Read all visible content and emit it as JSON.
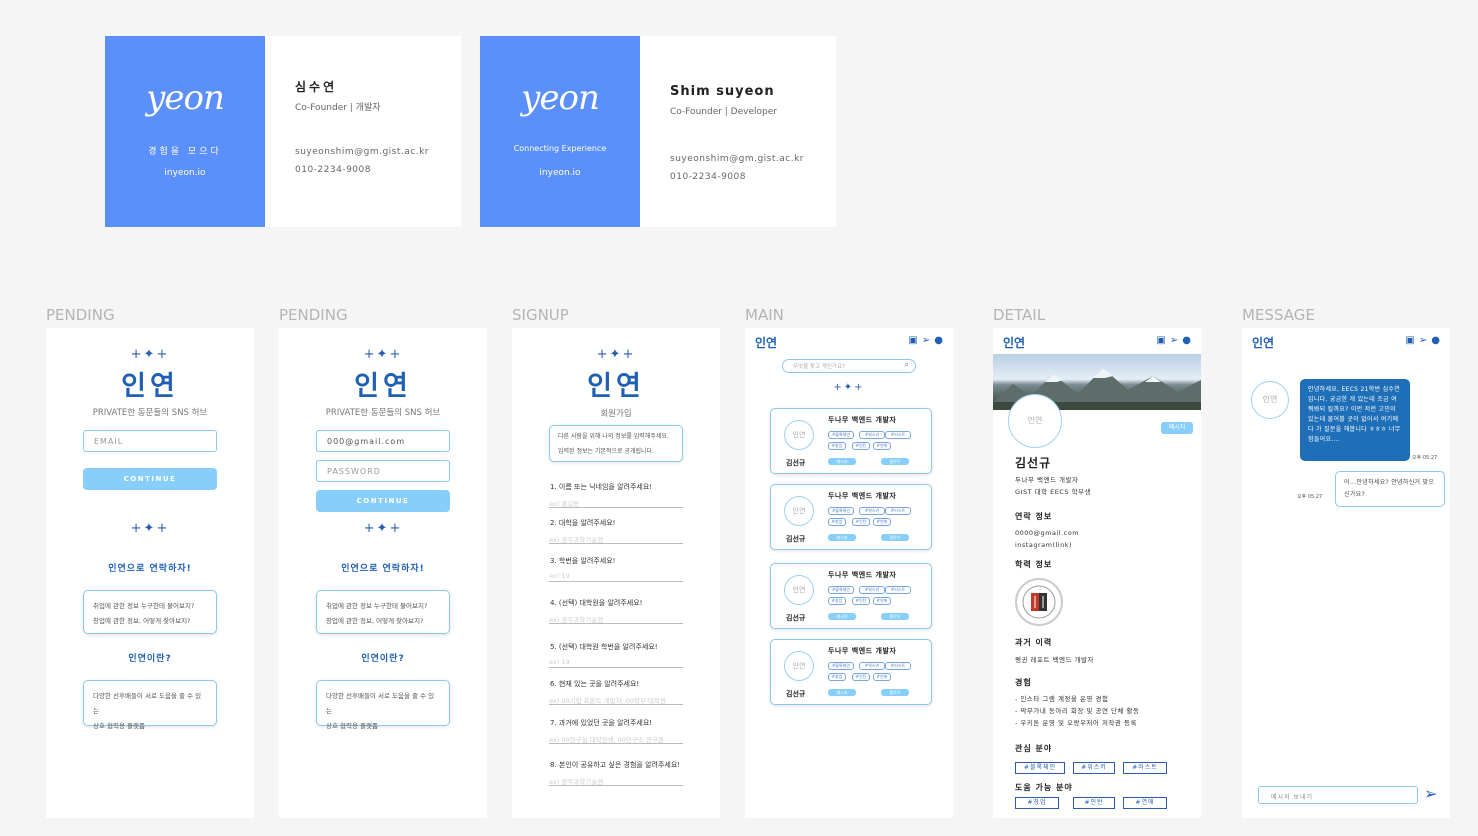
{
  "cards": [
    {
      "logo": "yeon",
      "tagline": "경험을 모으다",
      "site": "inyeon.io",
      "name": "심수연",
      "role": "Co-Founder | 개발자",
      "email": "suyeonshim@gm.gist.ac.kr",
      "phone": "010-2234-9008"
    },
    {
      "logo": "yeon",
      "tagline": "Connecting Experience",
      "site": "inyeon.io",
      "name": "Shim suyeon",
      "role": "Co-Founder | Developer",
      "email": "suyeonshim@gm.gist.ac.kr",
      "phone": "010-2234-9008"
    }
  ],
  "screens": {
    "pending1": {
      "label": "PENDING",
      "sparkle": "+✦+",
      "brand": "인연",
      "subtitle": "PRIVATE한 동문들의 SNS 허브",
      "email_placeholder": "EMAIL",
      "continue": "CONTINUE",
      "sparkle2": "+✦+",
      "q1": "인연으로 연락하자!",
      "box1_line1": "취업에 관한 정보 누구한테 물어보지?",
      "box1_line2": "창업에 관한 정보, 어떻게 찾아보지?",
      "q2": "인연이란?",
      "box2_line1": "다양한 선후배들이 서로 도움을 줄 수 있는",
      "box2_line2": "상호 협력용 플랫폼"
    },
    "pending2": {
      "label": "PENDING",
      "sparkle": "+✦+",
      "brand": "인연",
      "subtitle": "PRIVATE한 동문들의 SNS 허브",
      "email_value": "000@gmail.com",
      "password_placeholder": "PASSWORD",
      "continue": "CONTINUE",
      "sparkle2": "+✦+",
      "q1": "인연으로 연락하자!",
      "box1_line1": "취업에 관한 정보 누구한테 물어보지?",
      "box1_line2": "창업에 관한 정보, 어떻게 찾아보지?",
      "q2": "인연이란?",
      "box2_line1": "다양한 선후배들이 서로 도움을 줄 수 있는",
      "box2_line2": "상호 협력용 플랫폼"
    },
    "signup": {
      "label": "SIGNUP",
      "sparkle": "+✦+",
      "brand": "인연",
      "subtitle": "회원가입",
      "notice_line1": "다른 사람을 위해 나의 정보를 입력해주세요.",
      "notice_line2": "입력된 정보는 기본적으로 공개됩니다.",
      "fields": [
        {
          "q": "1. 이름 또는 닉네임을 알려주세요!",
          "hint": "ex) 홍길동"
        },
        {
          "q": "2. 대학을 알려주세요!",
          "hint": "ex) 광주과학기술원"
        },
        {
          "q": "3. 학번을 알려주세요!",
          "hint": "ex) 19"
        },
        {
          "q": "4. (선택) 대학원을 알려주세요!",
          "hint": "ex) 광주과학기술원"
        },
        {
          "q": "5. (선택) 대학원 학번을 알려주세요!",
          "hint": "ex) 19"
        },
        {
          "q": "6. 현재 있는 곳을 알려주세요!",
          "hint": "ex) 00기업 프론트 개발자, 00학부 대학원"
        },
        {
          "q": "7. 과거에 있었던 곳을 알려주세요!",
          "hint": "ex) 00연구실 대학원생, 00연구소 연구원"
        },
        {
          "q": "8. 본인이 공유하고 싶은 경험을 알려주세요!",
          "hint": "ex) 광주과학기술원"
        }
      ]
    },
    "main": {
      "label": "MAIN",
      "brand": "인연",
      "search_placeholder": "무엇을 찾고 계신가요?",
      "sparkle": "+✦+",
      "cards": [
        {
          "avatar": "인연",
          "name": "김선규",
          "title": "두나무 백엔드 개발자",
          "chips": [
            "#블록체인",
            "#위스키",
            "#러스트",
            "#창업",
            "#인턴",
            "#연애"
          ],
          "btn1": "메시지",
          "btn2": "팔로우"
        },
        {
          "avatar": "인연",
          "name": "김선규",
          "title": "두나무 백엔드 개발자",
          "chips": [
            "#블록체인",
            "#위스키",
            "#러스트",
            "#창업",
            "#인턴",
            "#연애"
          ],
          "btn1": "메시지",
          "btn2": "팔로우"
        },
        {
          "avatar": "인연",
          "name": "김선규",
          "title": "두나무 백엔드 개발자",
          "chips": [
            "#블록체인",
            "#위스키",
            "#러스트",
            "#창업",
            "#인턴",
            "#연애"
          ],
          "btn1": "메시지",
          "btn2": "팔로우"
        },
        {
          "avatar": "인연",
          "name": "김선규",
          "title": "두나무 백엔드 개발자",
          "chips": [
            "#블록체인",
            "#위스키",
            "#러스트",
            "#창업",
            "#인턴",
            "#연애"
          ],
          "btn1": "메시지",
          "btn2": "팔로우"
        }
      ]
    },
    "detail": {
      "label": "DETAIL",
      "brand": "인연",
      "avatar": "인연",
      "message_btn": "메시지",
      "name": "김선규",
      "line1": "두나무 백엔드 개발자",
      "line2": "GIST 대학 EECS 학부생",
      "contact_h": "연락 정보",
      "contact1": "0000@gmail.com",
      "contact2": "instagram(link)",
      "edu_h": "학력 정보",
      "past_h": "과거 이력",
      "past1": "펭귄 레포트 백엔드 개발자",
      "exp_h": "경험",
      "exp1": "- 인스타 그램 계정을 운영 경험",
      "exp2": "- 막무가내 동아리 회장 및 공연 단체 활동",
      "exp3": "- 우키톤 운영 및 오랑우저어 저작권 등록",
      "interest_h": "관심 분야",
      "interests": [
        "#블록체인",
        "#위스키",
        "#러스트"
      ],
      "help_h": "도움 가능 분야",
      "helps": [
        "#창업",
        "#인턴",
        "#연애"
      ]
    },
    "message": {
      "label": "MESSAGE",
      "brand": "인연",
      "avatar": "인연",
      "incoming": "안녕하세요, EECS 21학번 심수연입니다. 궁금한 게 있는데 조금 여쭤봐되 될까요? 이런 저런 고민이 있는데 물어볼 곳이 없어서 여기에다 가 질문을 해봅니다 ㅎㅎㅎ 너무 힘들어요....",
      "incoming_time": "오후 05:27",
      "outgoing": "어...안녕하세요? 안녕하신거 맞으신가요?",
      "outgoing_time": "오후 05:27",
      "input_placeholder": "메시지 보내기"
    }
  },
  "colors": {
    "brand_blue": "#1f5fb4",
    "card_blue": "#5b8ff9",
    "sky": "#87cefa",
    "bubble": "#1f6fb8"
  }
}
